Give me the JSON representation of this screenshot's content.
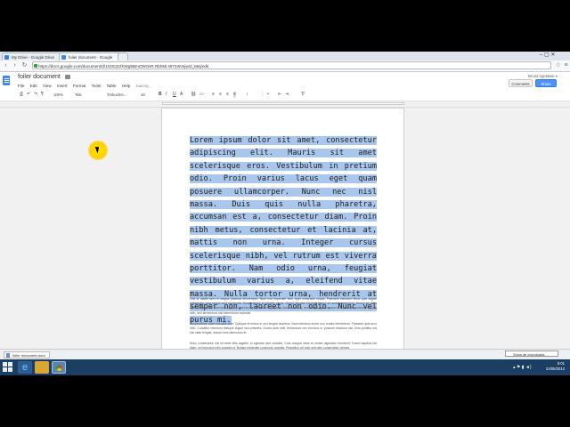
{
  "browser": {
    "tabs": [
      {
        "label": "My Drive - Google Drive"
      },
      {
        "label": "foiler document - Google"
      },
      {
        "label": ""
      }
    ],
    "url": "https://docs.google.com/document/d/1G0CZcfKWg5BmCWOsR.RbhMi.stt733iVejw/d_Mej/edit",
    "window_controls": "–  ▢  ✕"
  },
  "docs": {
    "title": "foiler document",
    "menu": [
      "File",
      "Edit",
      "View",
      "Insert",
      "Format",
      "Tools",
      "Table",
      "Help"
    ],
    "saving_status": "Saving...",
    "user": "Bruno Agostiver ▾",
    "comments_label": "Comments",
    "share_label": "Share",
    "toolbar": {
      "zoom": "100%",
      "style": "Title",
      "font": "Trebuchet...",
      "size": "18"
    },
    "selected_paragraph": "Lorem ipsum dolor sit amet, consectetur adipiscing elit. Mauris sit amet scelerisque eros. Vestibulum in pretium odio. Proin varius lacus eget quam posuere ullamcorper. Nunc nec nisl massa. Duis quis nulla pharetra, accumsan est a, consectetur diam. Proin nibh metus, consectetur et lacinia at, mattis non urna. Integer cursus scelerisque nibh, vel rutrum est viverra porttitor. Nam odio urna, feugiat vestibulum varius a, eleifend vitae massa. Nulla tortor urna, hendrerit at semper non, laoreet non odio. Nunc vel purus mi.",
    "small_paragraphs": [
      "Orci id mattis sem in magna placerat elementum. Nam non imperdiet felis, eget venenatis neque. Praesent interdum tellus quis augue sollicitudin, quis varius velit commodo. Suspendisse id lobortis purus. Donec fringilla volutpat augue sit amet elementum. Donec sit diam ante nisi posuere commodo quis sit amet lectus. Vestibulum placerat dolor maximus, nec blandit ligula ornare in. Curabitur vestibulum quam nibh, sed fermentum nisl elementum molestie.",
      "Suspendisse vitae convallis ante. Quisque et metus in orci feugiat faucibus. Nam interdum lorem non ornare fermentum. Praesent quis arcu nibh. Curabitur interdum tristique augue sed pharetra. Donec ante velit, fermentum nec rhoncus in, posuere tincidunt nisi. Duis porttitor est nisi vitae feugiat, dictum eros bibendum et.",
      "Nunc consectetur nisl sit amet felis sagittis, et egestas sem sodales. Cras congue diam at ornare dignissim hendrerit. Fusce dapibus dui diam, vel euismod nibh sodales id. Nullam imperdiet commodo gravida. Phasellus vel odio sed nibh consectetur ultrices."
    ]
  },
  "download": {
    "file": "foiler document.docx",
    "show_all": "Show all downloads..."
  },
  "taskbar": {
    "time": "6:01",
    "date": "24/05/2013",
    "lang": "ENG"
  }
}
